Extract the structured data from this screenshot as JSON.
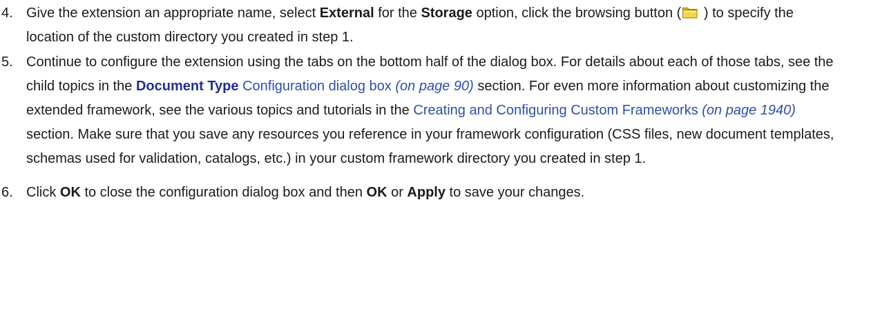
{
  "steps": [
    {
      "number": "4.",
      "text_a": "Give the extension an appropriate name, select ",
      "bold_1": "External",
      "text_b": " for the ",
      "bold_2": "Storage",
      "text_c": " option, click the browsing button (",
      "icon": "folder-icon",
      "text_d": " ) to specify the location of the custom directory you created in step 1."
    },
    {
      "number": "5.",
      "text_a": "Continue to configure the extension using the tabs on the bottom half of the dialog box. For details about each of those tabs, see the child topics in the ",
      "link_bold": "Document Type",
      "link_1": " Configuration dialog box",
      "page_ref_1": " (on page 90)",
      "text_b": " section. For even more information about customizing the extended framework, see the various topics and tutorials in the ",
      "link_2": "Creating and Configuring Custom Frameworks",
      "page_ref_2": " (on page 1940)",
      "text_c": " section. Make sure that you save any resources you reference in your framework configuration (CSS files, new document templates, schemas used for validation, catalogs, etc.) in your custom framework directory you created in step 1."
    },
    {
      "number": "6.",
      "text_a": "Click ",
      "bold_1": "OK",
      "text_b": " to close the configuration dialog box and then ",
      "bold_2": "OK",
      "text_c": " or ",
      "bold_3": "Apply",
      "text_d": " to save your changes."
    }
  ],
  "colors": {
    "text": "#1a1a1a",
    "link": "#2e4fa8",
    "link_bold": "#1f2f93",
    "folder_fill": "#f5d54a",
    "folder_tab": "#e8b820",
    "folder_stroke": "#9a7a12"
  }
}
